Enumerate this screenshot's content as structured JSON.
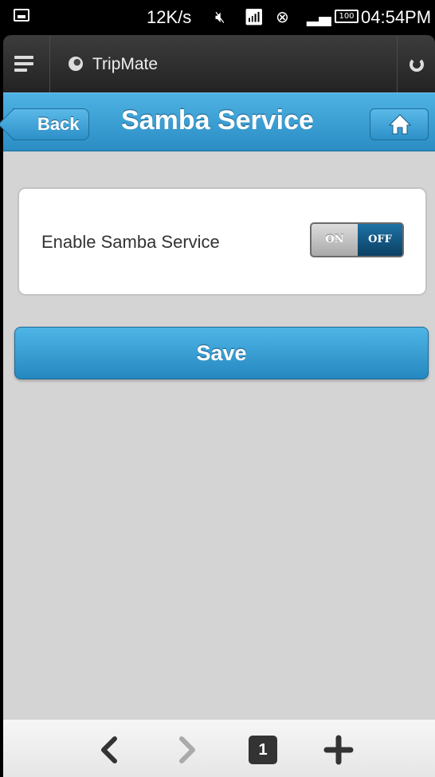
{
  "status_bar": {
    "speed": "12K/s",
    "battery": "100",
    "time": "04:54PM"
  },
  "app_bar": {
    "title": "TripMate"
  },
  "header": {
    "back_label": "Back",
    "title": "Samba Service"
  },
  "settings": {
    "samba_label": "Enable Samba Service",
    "toggle_on_label": "ON",
    "toggle_off_label": "OFF",
    "toggle_state": "OFF"
  },
  "actions": {
    "save_label": "Save"
  },
  "bottom_nav": {
    "tab_count": "1"
  },
  "colors": {
    "accent": "#2a8dc4",
    "content_bg": "#d4d4d4",
    "toggle_off": "#0f4f7a"
  }
}
